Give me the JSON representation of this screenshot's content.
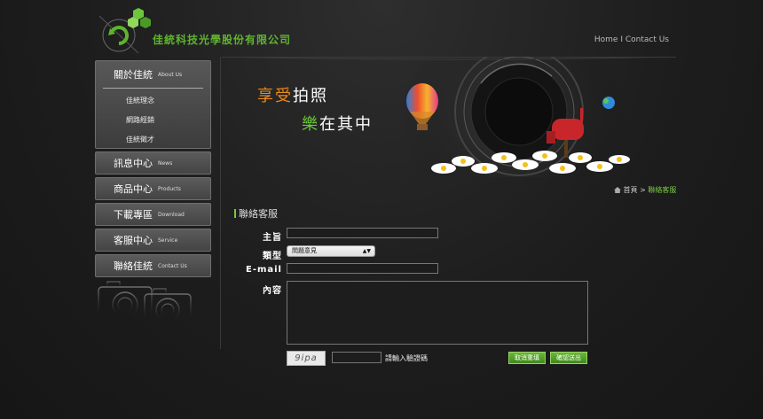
{
  "header": {
    "company_name": "佳統科技光學股份有限公司",
    "home_link": "Home",
    "separator": "I",
    "contact_link": "Contact Us"
  },
  "sidebar": {
    "open_menu": {
      "zh": "關於佳統",
      "en": "About Us",
      "subitems": [
        "佳統理念",
        "網路經銷",
        "佳統徵才"
      ]
    },
    "items": [
      {
        "zh": "訊息中心",
        "en": "News"
      },
      {
        "zh": "商品中心",
        "en": "Products"
      },
      {
        "zh": "下載專區",
        "en": "Download"
      },
      {
        "zh": "客服中心",
        "en": "Service"
      },
      {
        "zh": "聯絡佳統",
        "en": "Contact Us"
      }
    ]
  },
  "banner": {
    "line1_accent": "享受",
    "line1_rest": "拍照",
    "line2_accent": "樂",
    "line2_rest": "在其中"
  },
  "breadcrumb": {
    "home": "首頁",
    "separator": ">",
    "current": "聯絡客服"
  },
  "section_title": "聯絡客服",
  "form": {
    "subject_label": "主旨",
    "type_label": "類型",
    "type_value": "問題意見",
    "email_label": "E-mail",
    "content_label": "內容",
    "captcha_text": "9ipa",
    "captcha_hint": "請輸入驗證碼",
    "reset_label": "取消重填",
    "submit_label": "確認送出"
  },
  "colors": {
    "accent_green": "#7bc843",
    "brand_green": "#5fb32f",
    "accent_orange": "#f08a1c"
  }
}
